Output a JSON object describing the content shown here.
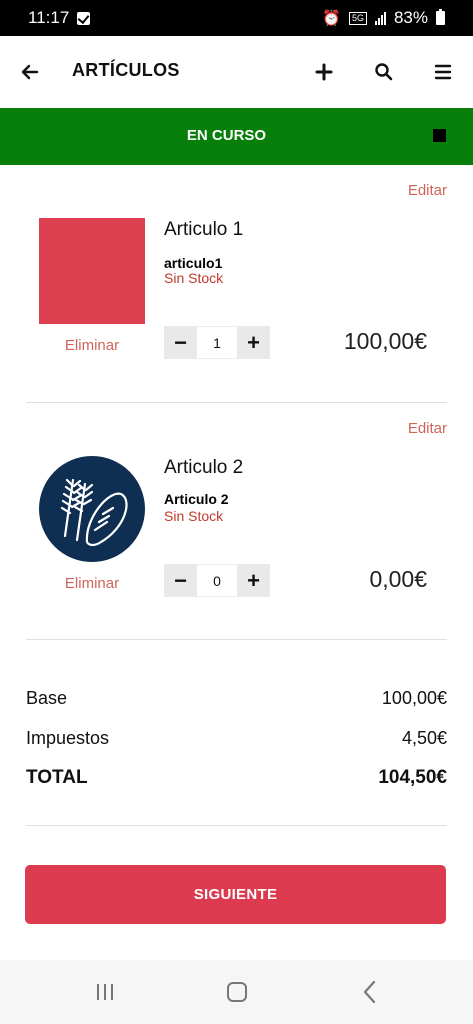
{
  "status_bar": {
    "time": "11:17",
    "battery": "83%",
    "network": "5G"
  },
  "app_bar": {
    "title": "ARTÍCULOS"
  },
  "status_band": {
    "label": "EN CURSO",
    "color": "#087f0a"
  },
  "items": [
    {
      "edit_label": "Editar",
      "name": "Articulo 1",
      "code": "articulo1",
      "stock": "Sin Stock",
      "delete_label": "Eliminar",
      "quantity": "1",
      "price": "100,00€",
      "thumb_color": "#dd4050"
    },
    {
      "edit_label": "Editar",
      "name": "Articulo 2",
      "code": "Articulo 2",
      "stock": "Sin Stock",
      "delete_label": "Eliminar",
      "quantity": "0",
      "price": "0,00€",
      "thumb_icon": "bread-wheat-logo"
    }
  ],
  "summary": {
    "base_label": "Base",
    "base_value": "100,00€",
    "tax_label": "Impuestos",
    "tax_value": "4,50€",
    "total_label": "TOTAL",
    "total_value": "104,50€"
  },
  "next_button": {
    "label": "SIGUIENTE",
    "color": "#dc3a4e"
  },
  "colors": {
    "accent": "#dc3a4e",
    "link": "#d0645a",
    "stock_warning": "#c0392b"
  }
}
